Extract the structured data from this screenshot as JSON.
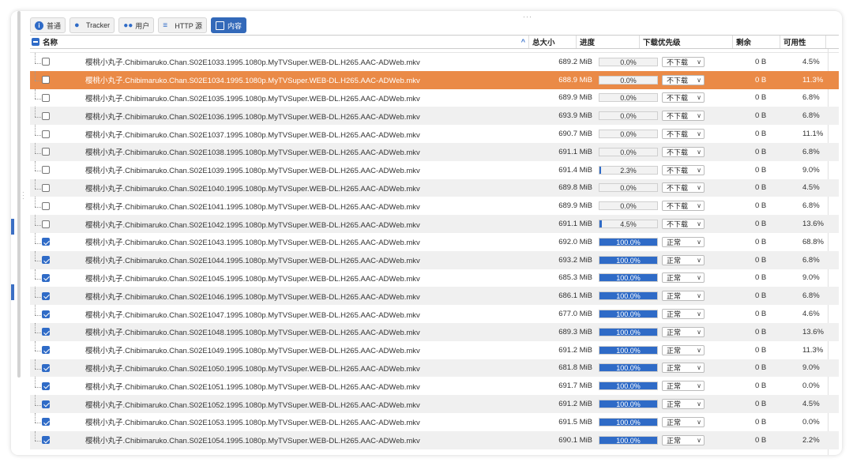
{
  "tabs": [
    {
      "label": "普通",
      "icon": "info-icon",
      "active": false
    },
    {
      "label": "Tracker",
      "icon": "map-pin-icon",
      "active": false
    },
    {
      "label": "用户",
      "icon": "users-icon",
      "active": false
    },
    {
      "label": "HTTP 源",
      "icon": "database-icon",
      "active": false
    },
    {
      "label": "内容",
      "icon": "content-icon",
      "active": true
    }
  ],
  "columns": {
    "name": "名称",
    "size": "总大小",
    "progress": "进度",
    "priority": "下载优先级",
    "remaining": "剩余",
    "availability": "可用性"
  },
  "colors": {
    "accent": "#2f6bc7",
    "selected_row": "#ea8a47"
  },
  "files": [
    {
      "name": "樱桃小丸子.Chibimaruko.Chan.S02E1033.1995.1080p.MyTVSuper.WEB-DL.H265.AAC-ADWeb.mkv",
      "size": "689.2 MiB",
      "progress": 0.0,
      "progress_text": "0.0%",
      "priority": "不下载",
      "remaining": "0 B",
      "availability": "4.5%",
      "checked": false,
      "selected": false
    },
    {
      "name": "樱桃小丸子.Chibimaruko.Chan.S02E1034.1995.1080p.MyTVSuper.WEB-DL.H265.AAC-ADWeb.mkv",
      "size": "688.9 MiB",
      "progress": 0.0,
      "progress_text": "0.0%",
      "priority": "不下载",
      "remaining": "0 B",
      "availability": "11.3%",
      "checked": false,
      "selected": true
    },
    {
      "name": "樱桃小丸子.Chibimaruko.Chan.S02E1035.1995.1080p.MyTVSuper.WEB-DL.H265.AAC-ADWeb.mkv",
      "size": "689.9 MiB",
      "progress": 0.0,
      "progress_text": "0.0%",
      "priority": "不下载",
      "remaining": "0 B",
      "availability": "6.8%",
      "checked": false,
      "selected": false
    },
    {
      "name": "樱桃小丸子.Chibimaruko.Chan.S02E1036.1995.1080p.MyTVSuper.WEB-DL.H265.AAC-ADWeb.mkv",
      "size": "693.9 MiB",
      "progress": 0.0,
      "progress_text": "0.0%",
      "priority": "不下载",
      "remaining": "0 B",
      "availability": "6.8%",
      "checked": false,
      "selected": false
    },
    {
      "name": "樱桃小丸子.Chibimaruko.Chan.S02E1037.1995.1080p.MyTVSuper.WEB-DL.H265.AAC-ADWeb.mkv",
      "size": "690.7 MiB",
      "progress": 0.0,
      "progress_text": "0.0%",
      "priority": "不下载",
      "remaining": "0 B",
      "availability": "11.1%",
      "checked": false,
      "selected": false
    },
    {
      "name": "樱桃小丸子.Chibimaruko.Chan.S02E1038.1995.1080p.MyTVSuper.WEB-DL.H265.AAC-ADWeb.mkv",
      "size": "691.1 MiB",
      "progress": 0.0,
      "progress_text": "0.0%",
      "priority": "不下载",
      "remaining": "0 B",
      "availability": "6.8%",
      "checked": false,
      "selected": false
    },
    {
      "name": "樱桃小丸子.Chibimaruko.Chan.S02E1039.1995.1080p.MyTVSuper.WEB-DL.H265.AAC-ADWeb.mkv",
      "size": "691.4 MiB",
      "progress": 0.023,
      "progress_text": "2.3%",
      "priority": "不下载",
      "remaining": "0 B",
      "availability": "9.0%",
      "checked": false,
      "selected": false
    },
    {
      "name": "樱桃小丸子.Chibimaruko.Chan.S02E1040.1995.1080p.MyTVSuper.WEB-DL.H265.AAC-ADWeb.mkv",
      "size": "689.8 MiB",
      "progress": 0.0,
      "progress_text": "0.0%",
      "priority": "不下载",
      "remaining": "0 B",
      "availability": "4.5%",
      "checked": false,
      "selected": false
    },
    {
      "name": "樱桃小丸子.Chibimaruko.Chan.S02E1041.1995.1080p.MyTVSuper.WEB-DL.H265.AAC-ADWeb.mkv",
      "size": "689.9 MiB",
      "progress": 0.0,
      "progress_text": "0.0%",
      "priority": "不下载",
      "remaining": "0 B",
      "availability": "6.8%",
      "checked": false,
      "selected": false
    },
    {
      "name": "樱桃小丸子.Chibimaruko.Chan.S02E1042.1995.1080p.MyTVSuper.WEB-DL.H265.AAC-ADWeb.mkv",
      "size": "691.1 MiB",
      "progress": 0.045,
      "progress_text": "4.5%",
      "priority": "不下载",
      "remaining": "0 B",
      "availability": "13.6%",
      "checked": false,
      "selected": false
    },
    {
      "name": "樱桃小丸子.Chibimaruko.Chan.S02E1043.1995.1080p.MyTVSuper.WEB-DL.H265.AAC-ADWeb.mkv",
      "size": "692.0 MiB",
      "progress": 1.0,
      "progress_text": "100.0%",
      "priority": "正常",
      "remaining": "0 B",
      "availability": "68.8%",
      "checked": true,
      "selected": false
    },
    {
      "name": "樱桃小丸子.Chibimaruko.Chan.S02E1044.1995.1080p.MyTVSuper.WEB-DL.H265.AAC-ADWeb.mkv",
      "size": "693.2 MiB",
      "progress": 1.0,
      "progress_text": "100.0%",
      "priority": "正常",
      "remaining": "0 B",
      "availability": "6.8%",
      "checked": true,
      "selected": false
    },
    {
      "name": "樱桃小丸子.Chibimaruko.Chan.S02E1045.1995.1080p.MyTVSuper.WEB-DL.H265.AAC-ADWeb.mkv",
      "size": "685.3 MiB",
      "progress": 1.0,
      "progress_text": "100.0%",
      "priority": "正常",
      "remaining": "0 B",
      "availability": "9.0%",
      "checked": true,
      "selected": false
    },
    {
      "name": "樱桃小丸子.Chibimaruko.Chan.S02E1046.1995.1080p.MyTVSuper.WEB-DL.H265.AAC-ADWeb.mkv",
      "size": "686.1 MiB",
      "progress": 1.0,
      "progress_text": "100.0%",
      "priority": "正常",
      "remaining": "0 B",
      "availability": "6.8%",
      "checked": true,
      "selected": false
    },
    {
      "name": "樱桃小丸子.Chibimaruko.Chan.S02E1047.1995.1080p.MyTVSuper.WEB-DL.H265.AAC-ADWeb.mkv",
      "size": "677.0 MiB",
      "progress": 1.0,
      "progress_text": "100.0%",
      "priority": "正常",
      "remaining": "0 B",
      "availability": "4.6%",
      "checked": true,
      "selected": false
    },
    {
      "name": "樱桃小丸子.Chibimaruko.Chan.S02E1048.1995.1080p.MyTVSuper.WEB-DL.H265.AAC-ADWeb.mkv",
      "size": "689.3 MiB",
      "progress": 1.0,
      "progress_text": "100.0%",
      "priority": "正常",
      "remaining": "0 B",
      "availability": "13.6%",
      "checked": true,
      "selected": false
    },
    {
      "name": "樱桃小丸子.Chibimaruko.Chan.S02E1049.1995.1080p.MyTVSuper.WEB-DL.H265.AAC-ADWeb.mkv",
      "size": "691.2 MiB",
      "progress": 1.0,
      "progress_text": "100.0%",
      "priority": "正常",
      "remaining": "0 B",
      "availability": "11.3%",
      "checked": true,
      "selected": false
    },
    {
      "name": "樱桃小丸子.Chibimaruko.Chan.S02E1050.1995.1080p.MyTVSuper.WEB-DL.H265.AAC-ADWeb.mkv",
      "size": "681.8 MiB",
      "progress": 1.0,
      "progress_text": "100.0%",
      "priority": "正常",
      "remaining": "0 B",
      "availability": "9.0%",
      "checked": true,
      "selected": false
    },
    {
      "name": "樱桃小丸子.Chibimaruko.Chan.S02E1051.1995.1080p.MyTVSuper.WEB-DL.H265.AAC-ADWeb.mkv",
      "size": "691.7 MiB",
      "progress": 1.0,
      "progress_text": "100.0%",
      "priority": "正常",
      "remaining": "0 B",
      "availability": "0.0%",
      "checked": true,
      "selected": false
    },
    {
      "name": "樱桃小丸子.Chibimaruko.Chan.S02E1052.1995.1080p.MyTVSuper.WEB-DL.H265.AAC-ADWeb.mkv",
      "size": "691.2 MiB",
      "progress": 1.0,
      "progress_text": "100.0%",
      "priority": "正常",
      "remaining": "0 B",
      "availability": "4.5%",
      "checked": true,
      "selected": false
    },
    {
      "name": "樱桃小丸子.Chibimaruko.Chan.S02E1053.1995.1080p.MyTVSuper.WEB-DL.H265.AAC-ADWeb.mkv",
      "size": "691.5 MiB",
      "progress": 1.0,
      "progress_text": "100.0%",
      "priority": "正常",
      "remaining": "0 B",
      "availability": "0.0%",
      "checked": true,
      "selected": false
    },
    {
      "name": "樱桃小丸子.Chibimaruko.Chan.S02E1054.1995.1080p.MyTVSuper.WEB-DL.H265.AAC-ADWeb.mkv",
      "size": "690.1 MiB",
      "progress": 1.0,
      "progress_text": "100.0%",
      "priority": "正常",
      "remaining": "0 B",
      "availability": "2.2%",
      "checked": true,
      "selected": false
    }
  ]
}
